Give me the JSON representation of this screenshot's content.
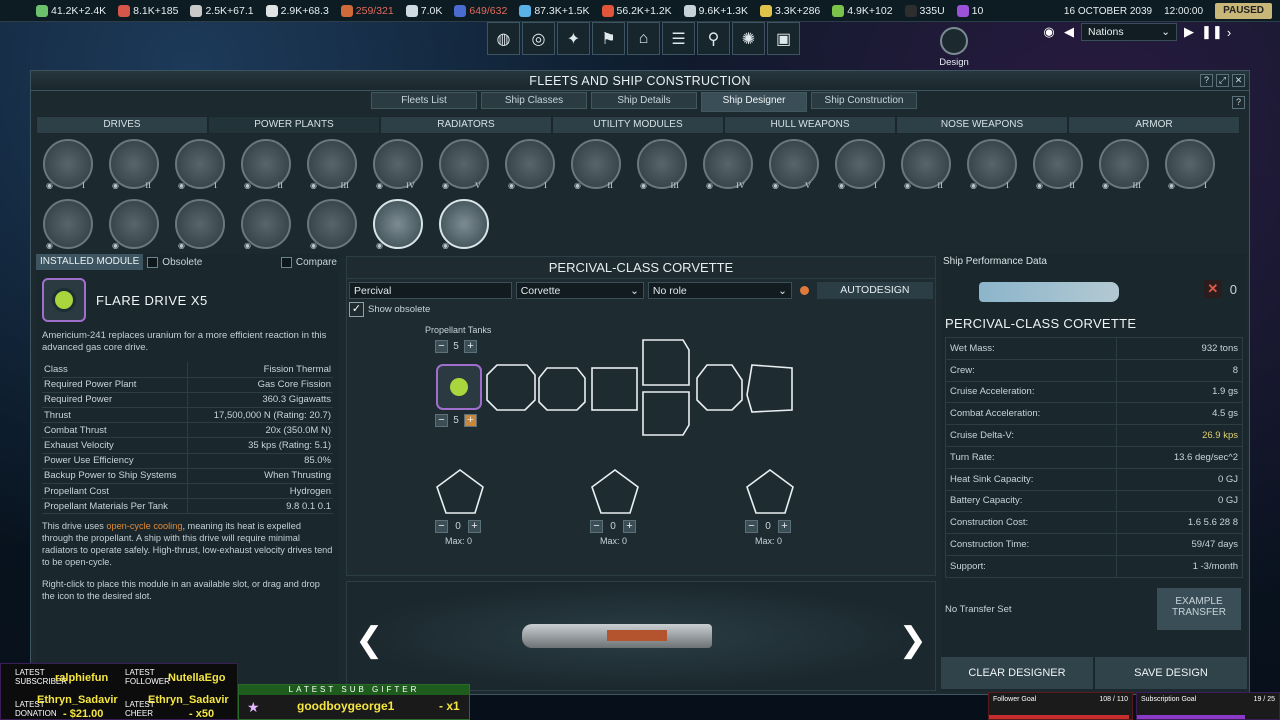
{
  "resources": [
    {
      "icon": "leaf-icon",
      "value": "41.2K+2.4K",
      "color": "#6cc26c",
      "red": false
    },
    {
      "icon": "bolt-icon",
      "value": "8.1K+185",
      "color": "#d6574a",
      "red": false
    },
    {
      "icon": "cross-icon",
      "value": "2.5K+67.1",
      "color": "#c9c9c9",
      "red": false
    },
    {
      "icon": "rocket-icon",
      "value": "2.9K+68.3",
      "color": "#dfe3e5",
      "red": false
    },
    {
      "icon": "flag-icon",
      "value": "259/321",
      "color": "#d06a3a",
      "red": true
    },
    {
      "icon": "flask-icon",
      "value": "7.0K",
      "color": "#cfdbe0",
      "red": false
    },
    {
      "icon": "mission-icon",
      "value": "649/632",
      "color": "#4a6bd0",
      "red": true
    },
    {
      "icon": "water-icon",
      "value": "87.3K+1.5K",
      "color": "#5bb2e6",
      "red": false
    },
    {
      "icon": "volatiles-icon",
      "value": "56.2K+1.2K",
      "color": "#e1563a",
      "red": false
    },
    {
      "icon": "metals-icon",
      "value": "9.6K+1.3K",
      "color": "#c7d2d8",
      "red": false
    },
    {
      "icon": "nobles-icon",
      "value": "3.3K+286",
      "color": "#e0c44a",
      "red": false
    },
    {
      "icon": "fissiles-icon",
      "value": "4.9K+102",
      "color": "#7ac24a",
      "red": false
    },
    {
      "icon": "antimatter-icon",
      "value": "335U",
      "color": "#2e2e2e",
      "red": false
    },
    {
      "icon": "exotics-icon",
      "value": "10",
      "color": "#9b52d8",
      "red": false
    }
  ],
  "date": "16 OCTOBER 2039",
  "time": "12:00:00",
  "status": "PAUSED",
  "nations_label": "Nations",
  "nav_icons": [
    "globe-icon",
    "council-icon",
    "tech-icon",
    "flag-icon",
    "hab-icon",
    "controls-icon",
    "probe-icon",
    "brain-icon",
    "window-icon"
  ],
  "design_label": "Design",
  "window": {
    "title": "FLEETS AND SHIP CONSTRUCTION",
    "help": "?",
    "tabs": [
      "Fleets List",
      "Ship Classes",
      "Ship Details",
      "Ship Designer",
      "Ship Construction"
    ],
    "active_tab": 3
  },
  "categories": [
    "DRIVES",
    "POWER PLANTS",
    "RADIATORS",
    "UTILITY MODULES",
    "HULL WEAPONS",
    "NOSE WEAPONS",
    "ARMOR"
  ],
  "active_category": 1,
  "modules_row1": [
    "I",
    "II",
    "I",
    "II",
    "III",
    "IV",
    "V",
    "I",
    "II",
    "III",
    "IV",
    "V",
    "I",
    "II",
    "I",
    "II",
    "III",
    "I"
  ],
  "modules_row2": [
    "",
    "",
    "",
    "",
    "",
    "",
    ""
  ],
  "installed": {
    "tab": "INSTALLED MODULE",
    "obsolete": "Obsolete",
    "compare": "Compare",
    "name": "FLARE DRIVE X5",
    "description": "Americium-241 replaces uranium for a more efficient reaction in this advanced gas core drive.",
    "stats": [
      {
        "k": "Class",
        "v": "Fission Thermal"
      },
      {
        "k": "Required Power Plant",
        "v": "Gas Core Fission"
      },
      {
        "k": "Required Power",
        "v": "360.3 Gigawatts"
      },
      {
        "k": "Thrust",
        "v": "17,500,000 N (Rating: 20.7)"
      },
      {
        "k": "Combat Thrust",
        "v": "20x (350.0M N)"
      },
      {
        "k": "Exhaust Velocity",
        "v": "35 kps (Rating: 5.1)"
      },
      {
        "k": "Power Use Efficiency",
        "v": "85.0%"
      },
      {
        "k": "Backup Power to Ship Systems",
        "v": "When Thrusting"
      },
      {
        "k": "Propellant Cost",
        "v": "Hydrogen"
      },
      {
        "k": "Propellant Materials Per Tank",
        "v": "9.8  0.1  0.1"
      }
    ],
    "note_pre": "This drive uses ",
    "note_hl": "open-cycle cooling",
    "note_post": ", meaning its heat is expelled through the propellant. A ship with this drive will require minimal radiators to operate safely. High-thrust, low-exhaust velocity drives tend to be open-cycle.",
    "help_text": "Right-click to place this module in an available slot, or drag and drop the icon to the desired slot."
  },
  "designer": {
    "title": "PERCIVAL-CLASS CORVETTE",
    "name": "Percival",
    "hull": "Corvette",
    "role": "No role",
    "autodesign": "AUTODESIGN",
    "show_obsolete": "Show obsolete",
    "propellant_label": "Propellant Tanks",
    "propellant_value": "5",
    "drive_value": "5",
    "weapon_slots": [
      {
        "value": "0",
        "max": "Max: 0"
      },
      {
        "value": "0",
        "max": "Max: 0"
      },
      {
        "value": "0",
        "max": "Max: 0"
      }
    ]
  },
  "performance": {
    "header": "Ship Performance Data",
    "unknown_count": "0",
    "title": "PERCIVAL-CLASS CORVETTE",
    "rows": [
      {
        "k": "Wet Mass:",
        "v": "932 tons"
      },
      {
        "k": "Crew:",
        "v": "8"
      },
      {
        "k": "Cruise Acceleration:",
        "v": "1.9 gs"
      },
      {
        "k": "Combat Acceleration:",
        "v": "4.5 gs"
      },
      {
        "k": "Cruise Delta-V:",
        "v": "26.9 kps"
      },
      {
        "k": "Turn Rate:",
        "v": "13.6 deg/sec^2"
      },
      {
        "k": "Heat Sink Capacity:",
        "v": "0 GJ"
      },
      {
        "k": "Battery Capacity:",
        "v": "0 GJ"
      },
      {
        "k": "Construction Cost:",
        "v": "1.6  5.6  28  8"
      },
      {
        "k": "Construction Time:",
        "v": "59/47 days"
      },
      {
        "k": "Support:",
        "v": "1  -3/month"
      }
    ],
    "no_transfer": "No Transfer Set",
    "example_transfer": "EXAMPLE TRANSFER",
    "clear": "CLEAR DESIGNER",
    "save": "SAVE DESIGN"
  },
  "overlay": {
    "latest_subscriber_label": "LATEST SUBSCRIBER",
    "latest_subscriber": "ralphiefun",
    "latest_follower_label": "LATEST FOLLOWER",
    "latest_follower": "NutellaEgo",
    "latest_donation_label": "LATEST DONATION",
    "latest_donation_name": "Ethryn_Sadavir",
    "latest_donation_amount": "- $21.00",
    "latest_cheer_label": "LATEST CHEER",
    "latest_cheer_name": "Ethryn_Sadavir",
    "latest_cheer_amount": "- x50",
    "gifter_title": "LATEST SUB GIFTER",
    "gifter_name": "goodboygeorge1",
    "gifter_amount": "- x1",
    "follower_goal": "Follower Goal",
    "follower_goal_count": "108 / 110",
    "follower_goal_progress": 0.98,
    "sub_goal": "Subscription Goal",
    "sub_goal_count": "19 / 25",
    "sub_goal_progress": 0.76
  }
}
